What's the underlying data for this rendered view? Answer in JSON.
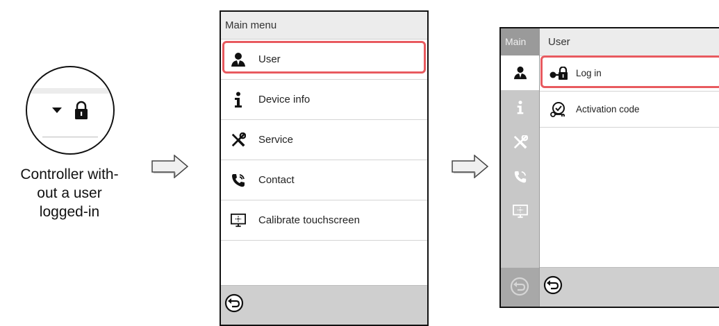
{
  "caption": {
    "lines": [
      "Controller with-",
      "out a user",
      "logged-in"
    ]
  },
  "screen1": {
    "title": "Main menu",
    "items": [
      {
        "label": "User",
        "icon": "user-icon"
      },
      {
        "label": "Device info",
        "icon": "info-icon"
      },
      {
        "label": "Service",
        "icon": "tools-icon"
      },
      {
        "label": "Contact",
        "icon": "phone-icon"
      },
      {
        "label": "Calibrate touchscreen",
        "icon": "touchscreen-icon"
      }
    ],
    "back_icon": "back-icon"
  },
  "screen2": {
    "side_title": "Main",
    "title": "User",
    "items": [
      {
        "label": "Log in",
        "icon": "login-lock-icon"
      },
      {
        "label": "Activation code",
        "icon": "activation-key-icon"
      }
    ]
  },
  "colors": {
    "highlight": "#e85a5f",
    "title_bar": "#ececec",
    "bottom_bar": "#cfcfcf",
    "sidebar": "#c8c8c8"
  }
}
